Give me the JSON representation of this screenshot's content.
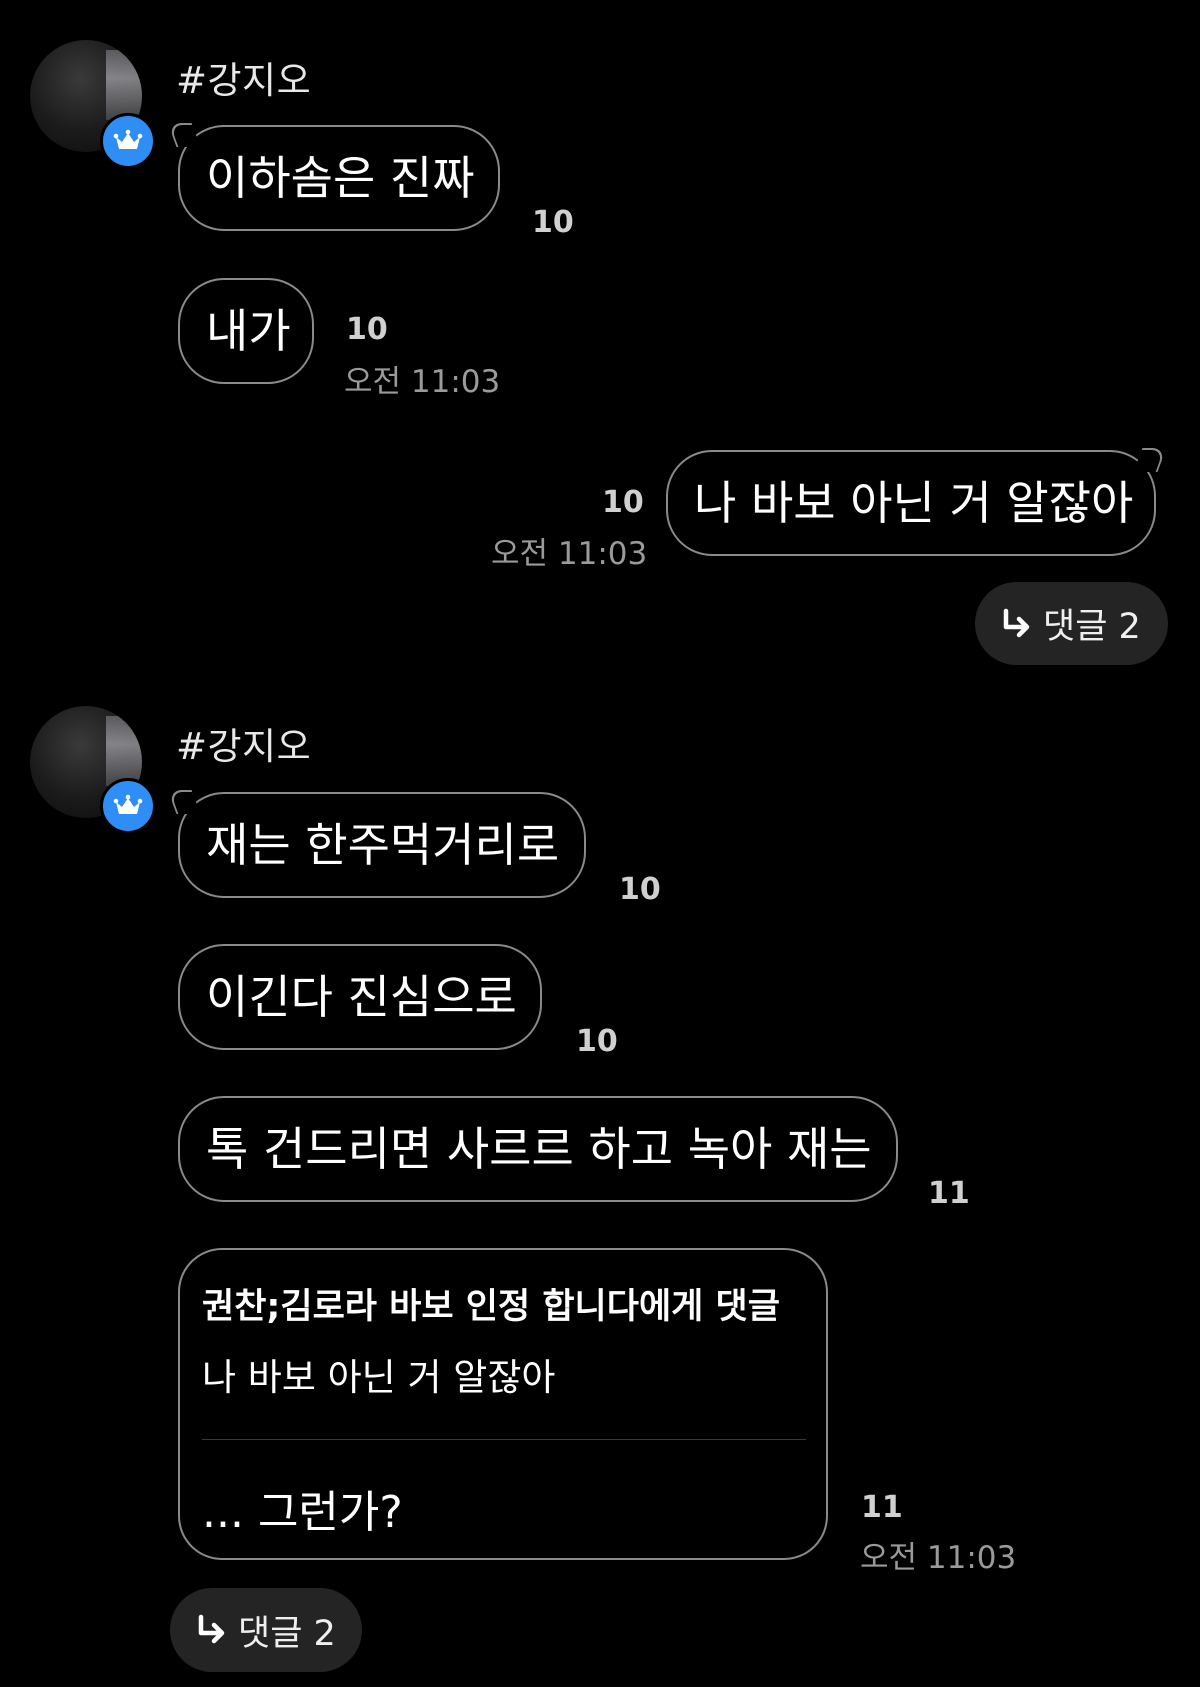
{
  "groups": [
    {
      "author": "#강지오",
      "messages": [
        {
          "text": "이하솜은 진짜",
          "count": "10",
          "time": ""
        },
        {
          "text": "내가",
          "count": "10",
          "time": "오전 11:03"
        }
      ]
    },
    {
      "author": "#강지오",
      "messages": [
        {
          "text": "재는 한주먹거리로",
          "count": "10",
          "time": ""
        },
        {
          "text": "이긴다 진심으로",
          "count": "10",
          "time": ""
        },
        {
          "text": "톡 건드리면 사르르 하고 녹아 재는",
          "count": "11",
          "time": ""
        }
      ],
      "quote": {
        "header": "권찬;김로라 바보 인정 합니다에게 댓글",
        "quoted_text": "나 바보 아닌 거 알잖아",
        "reply_text": "... 그런가?",
        "count": "11",
        "time": "오전 11:03"
      },
      "reply_button": {
        "label": "댓글 2"
      }
    }
  ],
  "outgoing": {
    "text": "나 바보 아닌 거 알잖아",
    "count": "10",
    "time": "오전 11:03",
    "reply_button": {
      "label": "댓글 2"
    }
  },
  "icons": {
    "badge": "crown-icon",
    "reply": "reply-arrow-icon"
  },
  "colors": {
    "background": "#000000",
    "badge": "#2f8ef5",
    "bubble_border": "#8a8a8a",
    "reply_button_bg": "#242424"
  }
}
